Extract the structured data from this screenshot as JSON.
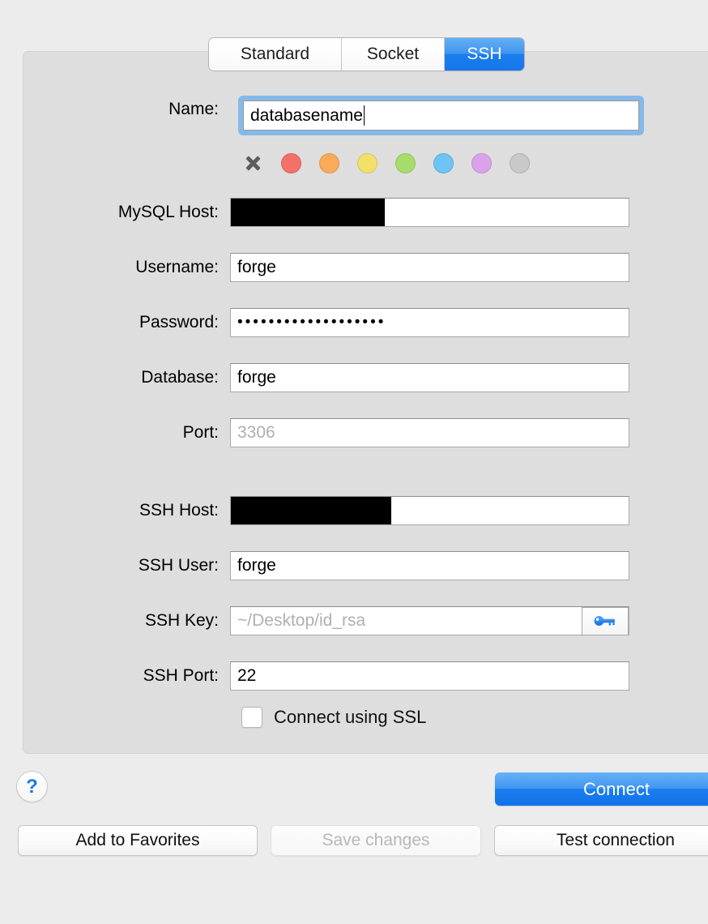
{
  "tabs": [
    {
      "label": "Standard",
      "active": false
    },
    {
      "label": "Socket",
      "active": false
    },
    {
      "label": "SSH",
      "active": true
    }
  ],
  "form": {
    "name": {
      "label": "Name:",
      "value": "databasename",
      "focused": true
    },
    "mysql_host": {
      "label": "MySQL Host:",
      "value": "",
      "redacted": true
    },
    "username": {
      "label": "Username:",
      "value": "forge"
    },
    "password": {
      "label": "Password:",
      "value": "•••••••••••••••••••"
    },
    "database": {
      "label": "Database:",
      "value": "forge"
    },
    "port": {
      "label": "Port:",
      "value": "",
      "placeholder": "3306"
    },
    "ssh_host": {
      "label": "SSH Host:",
      "value": "",
      "redacted": true
    },
    "ssh_user": {
      "label": "SSH User:",
      "value": "forge"
    },
    "ssh_key": {
      "label": "SSH Key:",
      "value": "",
      "placeholder": "~/Desktop/id_rsa",
      "button_icon": "key-icon"
    },
    "ssh_port": {
      "label": "SSH Port:",
      "value": "22"
    }
  },
  "swatches": {
    "clear_icon": "x-icon",
    "colors": [
      {
        "name": "red",
        "hex": "#f4716a"
      },
      {
        "name": "orange",
        "hex": "#f8ab58"
      },
      {
        "name": "yellow",
        "hex": "#f2e06a"
      },
      {
        "name": "green",
        "hex": "#a8dc6a"
      },
      {
        "name": "blue",
        "hex": "#6ec4f4"
      },
      {
        "name": "purple",
        "hex": "#dba2ec"
      },
      {
        "name": "gray",
        "hex": "#c9c9c9"
      }
    ]
  },
  "ssl": {
    "label": "Connect using SSL",
    "checked": false
  },
  "buttons": {
    "help": "?",
    "connect": "Connect",
    "add_to_favorites": "Add to Favorites",
    "save_changes": "Save changes",
    "test_connection": "Test connection"
  },
  "colors": {
    "accent": "#1a7ded",
    "panel_bg": "#dedede",
    "window_bg": "#ececec"
  }
}
